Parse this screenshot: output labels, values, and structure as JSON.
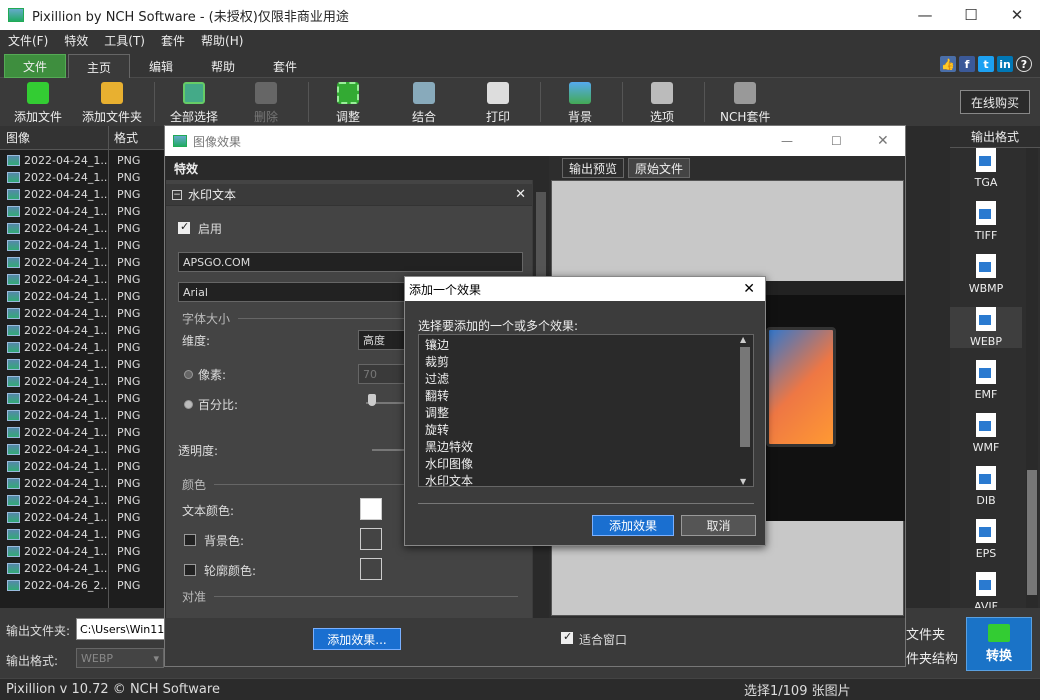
{
  "window": {
    "title": "Pixillion by NCH Software - (未授权)仅限非商业用途",
    "min": "—",
    "max": "☐",
    "close": "✕"
  },
  "menu": [
    "文件(F)",
    "特效",
    "工具(T)",
    "套件",
    "帮助(H)"
  ],
  "tabs": [
    "文件",
    "主页",
    "编辑",
    "帮助",
    "套件"
  ],
  "toolbar": {
    "add_file": "添加文件",
    "add_folder": "添加文件夹",
    "select_all": "全部选择",
    "delete": "删除",
    "adjust": "调整",
    "combine": "结合",
    "print": "打印",
    "background": "背景",
    "options": "选项",
    "nch_suite": "NCH套件",
    "buy": "在线购买"
  },
  "file_list": {
    "col_image": "图像",
    "col_format": "格式",
    "rows": [
      {
        "name": "2022-04-24_1...",
        "format": "PNG"
      },
      {
        "name": "2022-04-24_1...",
        "format": "PNG"
      },
      {
        "name": "2022-04-24_1...",
        "format": "PNG"
      },
      {
        "name": "2022-04-24_1...",
        "format": "PNG"
      },
      {
        "name": "2022-04-24_1...",
        "format": "PNG"
      },
      {
        "name": "2022-04-24_1...",
        "format": "PNG"
      },
      {
        "name": "2022-04-24_1...",
        "format": "PNG"
      },
      {
        "name": "2022-04-24_1...",
        "format": "PNG"
      },
      {
        "name": "2022-04-24_1...",
        "format": "PNG"
      },
      {
        "name": "2022-04-24_1...",
        "format": "PNG"
      },
      {
        "name": "2022-04-24_1...",
        "format": "PNG"
      },
      {
        "name": "2022-04-24_1...",
        "format": "PNG"
      },
      {
        "name": "2022-04-24_1...",
        "format": "PNG"
      },
      {
        "name": "2022-04-24_1...",
        "format": "PNG"
      },
      {
        "name": "2022-04-24_1...",
        "format": "PNG"
      },
      {
        "name": "2022-04-24_1...",
        "format": "PNG"
      },
      {
        "name": "2022-04-24_1...",
        "format": "PNG"
      },
      {
        "name": "2022-04-24_1...",
        "format": "PNG"
      },
      {
        "name": "2022-04-24_1...",
        "format": "PNG"
      },
      {
        "name": "2022-04-24_1...",
        "format": "PNG"
      },
      {
        "name": "2022-04-24_1...",
        "format": "PNG"
      },
      {
        "name": "2022-04-24_1...",
        "format": "PNG"
      },
      {
        "name": "2022-04-24_1...",
        "format": "PNG"
      },
      {
        "name": "2022-04-24_1...",
        "format": "PNG"
      },
      {
        "name": "2022-04-24_1...",
        "format": "PNG"
      },
      {
        "name": "2022-04-26_2...",
        "format": "PNG"
      }
    ]
  },
  "output_formats": {
    "header": "输出格式",
    "items": [
      "TGA",
      "TIFF",
      "WBMP",
      "WEBP",
      "EMF",
      "WMF",
      "DIB",
      "EPS",
      "AVIF"
    ]
  },
  "bottom": {
    "output_folder_label": "输出文件夹:",
    "output_folder_value": "C:\\Users\\Win11\\",
    "output_format_label": "输出格式:",
    "output_format_value": "WEBP",
    "right_label_1": "文件夹",
    "right_label_2": "件夹结构",
    "convert": "转换"
  },
  "status": {
    "version": "Pixillion v 10.72 © NCH Software",
    "selection": "选择1/109 张图片"
  },
  "effects_window": {
    "title": "图像效果",
    "effects_header": "特效",
    "panel_title": "水印文本",
    "enable": "启用",
    "text_value": "APSGO.COM",
    "font_value": "Arial",
    "font_size_group": "字体大小",
    "dimension_label": "维度:",
    "dimension_value": "高度",
    "pixels_label": "像素:",
    "pixels_value": "70",
    "percent_label": "百分比:",
    "opacity_label": "透明度:",
    "color_group": "颜色",
    "text_color_label": "文本颜色:",
    "bg_color_label": "背景色:",
    "outline_color_label": "轮廓颜色:",
    "align_group": "对准",
    "preview_tab": "输出预览",
    "original_tab": "原始文件",
    "add_effect_button": "添加效果...",
    "fit_window": "适合窗口"
  },
  "add_dialog": {
    "title": "添加一个效果",
    "prompt": "选择要添加的一个或多个效果:",
    "items": [
      "镶边",
      "裁剪",
      "过滤",
      "翻转",
      "调整",
      "旋转",
      "黑边特效",
      "水印图像",
      "水印文本"
    ],
    "ok": "添加效果",
    "cancel": "取消"
  }
}
